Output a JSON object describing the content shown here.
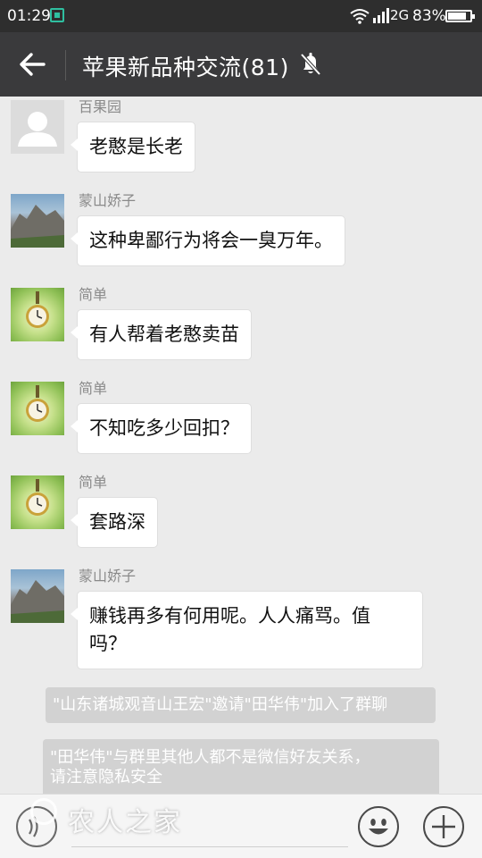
{
  "status_bar": {
    "time": "01:29",
    "app_icon": "screenshot-app-icon",
    "wifi_icon": "wifi-icon",
    "signal_icon": "cell-signal-icon",
    "network": "2G",
    "battery_percent": "83%",
    "battery_level": 0.83
  },
  "header": {
    "back_icon": "arrow-left-icon",
    "title": "苹果新品种交流(81)",
    "mute_icon": "bell-off-icon"
  },
  "messages": [
    {
      "sender": "百果园",
      "avatar": "default-person-avatar",
      "text": "老憨是长老"
    },
    {
      "sender": "蒙山娇子",
      "avatar": "mountain-photo-avatar",
      "text": "这种卑鄙行为将会一臭万年。"
    },
    {
      "sender": "简单",
      "avatar": "clock-photo-avatar",
      "text": "有人帮着老憨卖苗"
    },
    {
      "sender": "简单",
      "avatar": "clock-photo-avatar",
      "text": "不知吃多少回扣？"
    },
    {
      "sender": "简单",
      "avatar": "clock-photo-avatar",
      "text": "套路深"
    },
    {
      "sender": "蒙山娇子",
      "avatar": "mountain-photo-avatar",
      "text_line1": "赚钱再多有何用呢。人人痛骂。值",
      "text_line2": "吗？"
    }
  ],
  "system_notices": [
    {
      "text": "\"山东诸城观音山王宏\"邀请\"田华伟\"加入了群聊"
    },
    {
      "line1": "\"田华伟\"与群里其他人都不是微信好友关系，",
      "line2": "请注意隐私安全"
    }
  ],
  "input_bar": {
    "voice_icon": "voice-icon",
    "watermark_text": "农人之家",
    "emoji_icon": "smiley-icon",
    "plus_icon": "plus-icon"
  },
  "colors": {
    "status_bar_bg": "#2e2e2e",
    "title_bar_bg": "#3a3a3c",
    "chat_bg": "#ebebeb",
    "bubble_bg": "#ffffff",
    "notice_bg": "#d2d2d2"
  }
}
